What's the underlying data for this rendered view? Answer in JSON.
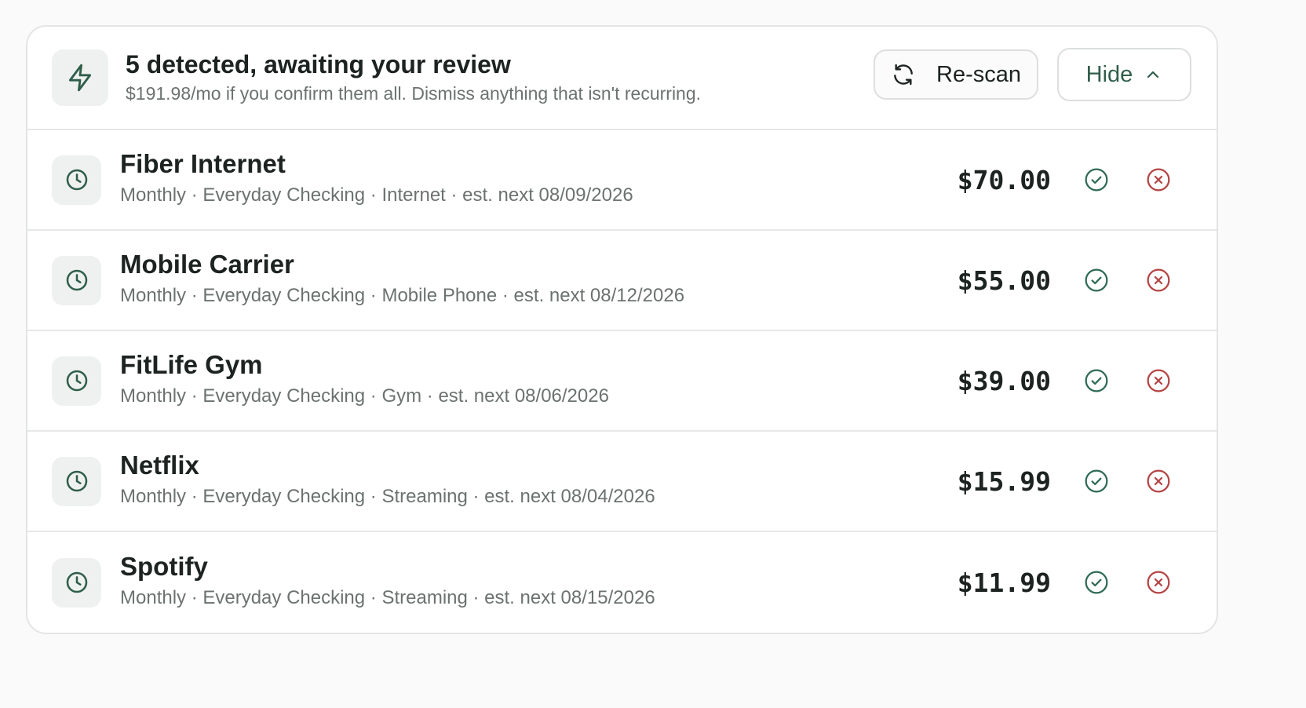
{
  "colors": {
    "accent": "#2f5e4a",
    "confirm": "#2f6b55",
    "dismiss": "#b54545",
    "icon": "#2f5e4a",
    "text": "#1c2321",
    "muted": "#6b7270"
  },
  "header": {
    "icon": "lightning-icon",
    "title": "5 detected, awaiting your review",
    "subtitle": "$191.98/mo if you confirm them all. Dismiss anything that isn't recurring.",
    "rescan_icon": "refresh-icon",
    "rescan_label": "Re-scan",
    "hide_label": "Hide",
    "hide_icon": "chevron-up-icon"
  },
  "items": [
    {
      "icon": "clock-icon",
      "name": "Fiber Internet",
      "meta": "Monthly · Everyday Checking · Internet · est. next 08/09/2026",
      "amount": "$70.00"
    },
    {
      "icon": "clock-icon",
      "name": "Mobile Carrier",
      "meta": "Monthly · Everyday Checking · Mobile Phone · est. next 08/12/2026",
      "amount": "$55.00"
    },
    {
      "icon": "clock-icon",
      "name": "FitLife Gym",
      "meta": "Monthly · Everyday Checking · Gym · est. next 08/06/2026",
      "amount": "$39.00"
    },
    {
      "icon": "clock-icon",
      "name": "Netflix",
      "meta": "Monthly · Everyday Checking · Streaming · est. next 08/04/2026",
      "amount": "$15.99"
    },
    {
      "icon": "clock-icon",
      "name": "Spotify",
      "meta": "Monthly · Everyday Checking · Streaming · est. next 08/15/2026",
      "amount": "$11.99"
    }
  ]
}
